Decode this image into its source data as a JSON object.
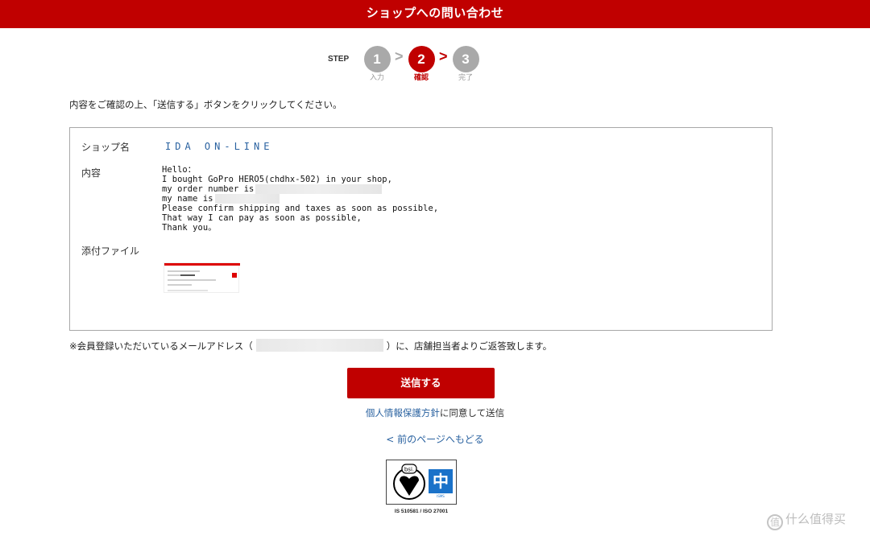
{
  "header": {
    "title": "ショップへの問い合わせ"
  },
  "steps": {
    "word": "STEP",
    "items": [
      {
        "number": "1",
        "label": "入力",
        "state": "done"
      },
      {
        "number": "2",
        "label": "確認",
        "state": "active"
      },
      {
        "number": "3",
        "label": "完了",
        "state": "pending"
      }
    ],
    "separator": ">"
  },
  "instruction": "内容をご確認の上、「送信する」ボタンをクリックしてください。",
  "form": {
    "shop_label": "ショップ名",
    "shop_value": "IDA ON-LINE",
    "content_label": "内容",
    "message_lines": [
      "Hello：",
      "I bought GoPro HERO5(chdhx-502) in your shop,",
      "my order number is",
      "my name is",
      "Please confirm shipping and taxes as soon as possible,",
      "That way I can pay as soon as possible,",
      "Thank you。"
    ],
    "attachment_label": "添付ファイル"
  },
  "notice": {
    "before": "※会員登録いただいているメールアドレス（",
    "after": "）に、店舗担当者よりご返答致します。"
  },
  "submit_label": "送信する",
  "privacy": {
    "link": "個人情報保護方針",
    "rest": "に同意して送信"
  },
  "back_link": "< 前のページへもどる",
  "certification": {
    "caption": "IS 510581 / ISO 27001",
    "badge_text": "bsi."
  },
  "watermark": {
    "icon_char": "值",
    "text": "什么值得买"
  },
  "colors": {
    "brand_red": "#c00000",
    "link_blue": "#2a62a0",
    "step_gray": "#a9a9a9"
  }
}
